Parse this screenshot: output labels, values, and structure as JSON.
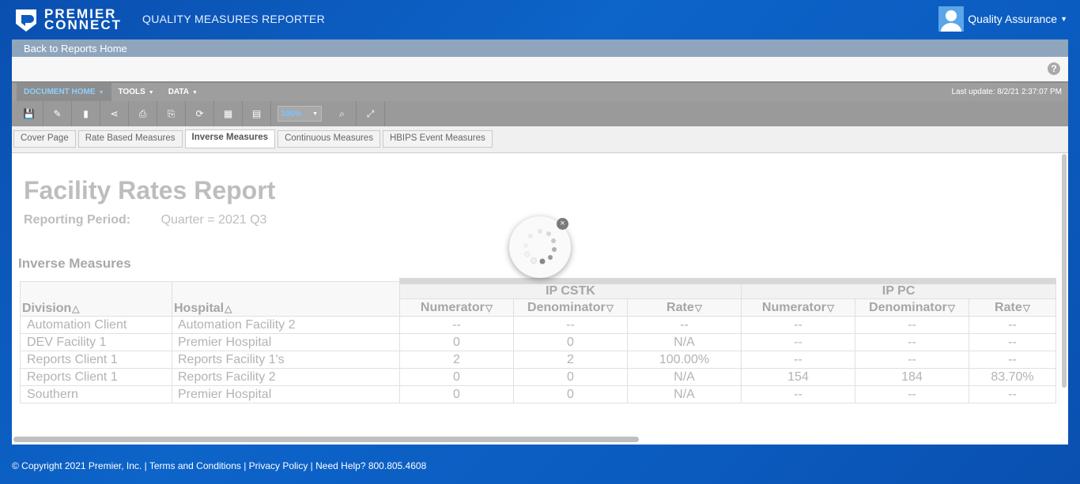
{
  "brand": {
    "line1": "PREMIER",
    "line2": "CONNECT",
    "app_title": "QUALITY MEASURES REPORTER"
  },
  "user": {
    "name": "Quality Assurance"
  },
  "nav": {
    "back_label": "Back to Reports Home",
    "help": "?"
  },
  "menus": [
    "DOCUMENT HOME",
    "TOOLS",
    "DATA"
  ],
  "last_update": "Last update: 8/2/21 2:37:07 PM",
  "toolbar": {
    "zoom": "100%"
  },
  "tabs": [
    "Cover Page",
    "Rate Based Measures",
    "Inverse Measures",
    "Continuous Measures",
    "HBIPS Event Measures"
  ],
  "report": {
    "title": "Facility Rates Report",
    "period_label": "Reporting Period:",
    "period_value": "Quarter = 2021 Q3",
    "section": "Inverse Measures",
    "group1": "IP CSTK",
    "group2": "IP PC",
    "columns": [
      "Division",
      "Hospital",
      "Numerator",
      "Denominator",
      "Rate",
      "Numerator",
      "Denominator",
      "Rate"
    ],
    "rows": [
      [
        "Automation Client",
        "Automation Facility 2",
        "--",
        "--",
        "--",
        "--",
        "--",
        "--"
      ],
      [
        "DEV Facility 1",
        "Premier Hospital",
        "0",
        "0",
        "N/A",
        "--",
        "--",
        "--"
      ],
      [
        "Reports Client 1",
        "Reports Facility 1's",
        "2",
        "2",
        "100.00%",
        "--",
        "--",
        "--"
      ],
      [
        "Reports Client 1",
        "Reports Facility 2",
        "0",
        "0",
        "N/A",
        "154",
        "184",
        "83.70%"
      ],
      [
        "Southern",
        "Premier Hospital",
        "0",
        "0",
        "N/A",
        "--",
        "--",
        "--"
      ]
    ]
  },
  "spinner": {
    "close": "×"
  },
  "footer": "© Copyright 2021 Premier, Inc. | Terms and Conditions | Privacy Policy | Need Help? 800.805.4608"
}
